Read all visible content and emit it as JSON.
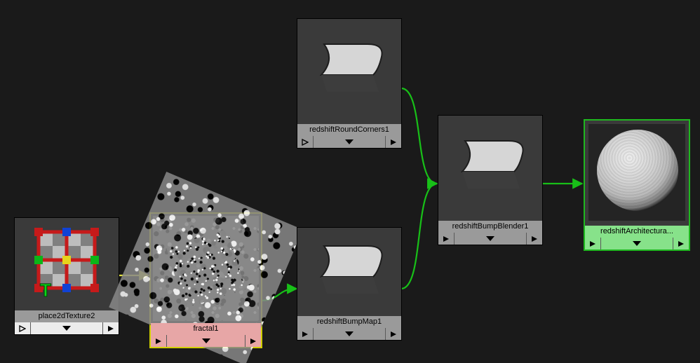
{
  "nodes": {
    "place2d": {
      "label": "place2dTexture2"
    },
    "fractal": {
      "label": "fractal1"
    },
    "roundCorners": {
      "label": "redshiftRoundCorners1"
    },
    "bumpMap": {
      "label": "redshiftBumpMap1"
    },
    "bumpBlender": {
      "label": "redshiftBumpBlender1"
    },
    "architectural": {
      "label": "redshiftArchitectura..."
    }
  }
}
